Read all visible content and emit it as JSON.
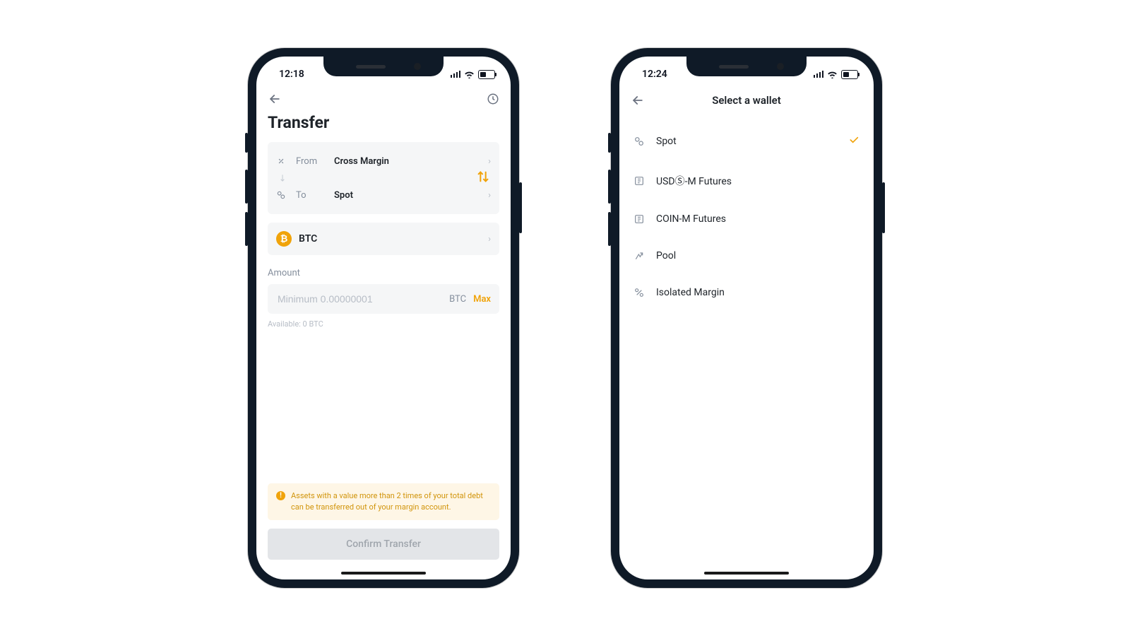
{
  "screen1": {
    "status_time": "12:18",
    "title": "Transfer",
    "from_label": "From",
    "from_value": "Cross Margin",
    "to_label": "To",
    "to_value": "Spot",
    "asset_symbol": "BTC",
    "amount_label": "Amount",
    "amount_placeholder": "Minimum 0.00000001",
    "amount_unit": "BTC",
    "amount_max": "Max",
    "available_text": "Available: 0 BTC",
    "note_text": "Assets with a value more than 2 times of your total debt can be transferred out of your margin account.",
    "confirm_label": "Confirm Transfer"
  },
  "screen2": {
    "status_time": "12:24",
    "title": "Select a wallet",
    "wallets": [
      {
        "name": "Spot",
        "selected": true
      },
      {
        "name": "USDⓈ-M Futures",
        "selected": false
      },
      {
        "name": "COIN-M Futures",
        "selected": false
      },
      {
        "name": "Pool",
        "selected": false
      },
      {
        "name": "Isolated Margin",
        "selected": false
      }
    ]
  },
  "colors": {
    "accent": "#f0a30a",
    "text": "#1e2329",
    "muted": "#848e9c",
    "panel": "#f5f6f7"
  }
}
